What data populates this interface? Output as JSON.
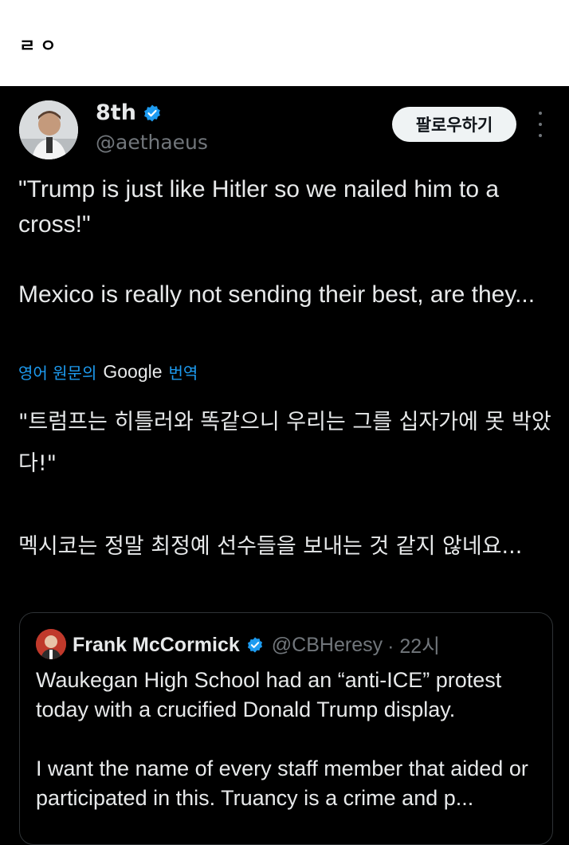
{
  "top_strip": {
    "text": "ㄹㅇ"
  },
  "author": {
    "name": "8th",
    "handle": "@aethaeus",
    "avatar_icon": "user-avatar-photo"
  },
  "actions": {
    "follow_label": "팔로우하기",
    "more_icon": "more-vertical-icon"
  },
  "tweet": {
    "text_original": "\"Trump is just like Hitler so we nailed him to a cross!\"\n\nMexico is really not sending their best, are they...",
    "translate_prefix": "영어 원문의",
    "translate_brand": "Google",
    "translate_suffix": "번역",
    "text_translated": "\"트럼프는 히틀러와 똑같으니 우리는 그를 십자가에 못 박았다!\"\n\n멕시코는 정말 최정예 선수들을 보내는 것 같지 않네요..."
  },
  "quote": {
    "name": "Frank McCormick",
    "handle": "@CBHeresy",
    "time": "· 22시",
    "text": "Waukegan High School had an “anti-ICE” protest today with a crucified Donald Trump display.\n\nI want the name of every staff member that aided or participated in this. Truancy is a crime and p..."
  },
  "colors": {
    "background": "#000000",
    "text": "#e7e9ea",
    "secondary": "#71767b",
    "link": "#1d9bf0",
    "verified": "#1d9bf0"
  }
}
